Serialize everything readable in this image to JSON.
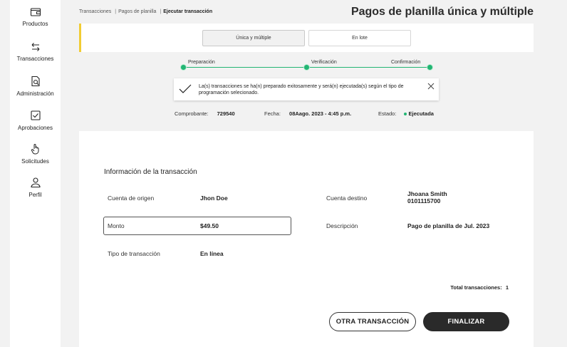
{
  "sidebar": {
    "items": [
      {
        "label": "Productos",
        "icon": "wallet-icon"
      },
      {
        "label": "Transacciones",
        "icon": "transfer-arrows-icon"
      },
      {
        "label": "Administración",
        "icon": "document-search-icon"
      },
      {
        "label": "Aprobaciones",
        "icon": "checkbox-icon"
      },
      {
        "label": "Solicitudes",
        "icon": "hand-pointer-icon"
      },
      {
        "label": "Perfil",
        "icon": "user-icon"
      }
    ]
  },
  "breadcrumb": {
    "items": [
      "Transacciones",
      "Pagos de planilla",
      "Ejecutar transacción"
    ]
  },
  "page_title": "Pagos de planilla única y múltiple",
  "tabs": [
    {
      "label": "Única y múltiple",
      "active": true
    },
    {
      "label": "En lote",
      "active": false
    }
  ],
  "stepper": {
    "steps": [
      "Preparación",
      "Verificación",
      "Confirmación"
    ],
    "color": "#22b573"
  },
  "alert": {
    "message": "La(s) transacciones se ha(n) preparado exitosamente y será(n) ejecutada(s) según el tipo de programación selecionado."
  },
  "summary": {
    "comprobante_label": "Comprobante:",
    "comprobante_value": "729540",
    "fecha_label": "Fecha:",
    "fecha_value": "08Aago. 2023 - 4:45 p.m.",
    "estado_label": "Estado:",
    "estado_value": "Ejecutada"
  },
  "transaction": {
    "section_title": "Información de la transacción",
    "origin_label": "Cuenta de origen",
    "origin_value": "Jhon Doe",
    "destination_label": "Cuenta destino",
    "destination_name": "Jhoana Smith",
    "destination_number": "0101115700",
    "amount_label": "Monto",
    "amount_value": "$49.50",
    "description_label": "Descripción",
    "description_value": "Pago de planilla de Jul. 2023",
    "type_label": "Tipo de transacción",
    "type_value": "En línea",
    "total_label": "Total transacciones:",
    "total_value": "1"
  },
  "buttons": {
    "other": "OTRA TRANSACCIÓN",
    "finish": "FINALIZAR"
  },
  "colors": {
    "accent_yellow": "#f1cc33",
    "success_green": "#22b573",
    "primary_dark": "#2a2a2a"
  }
}
